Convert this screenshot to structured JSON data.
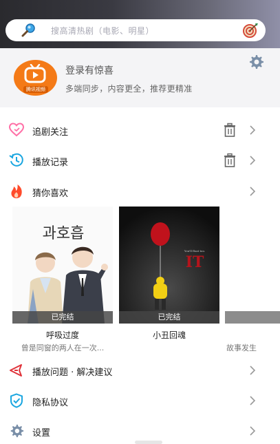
{
  "search": {
    "placeholder": "搜高清热剧（电影、明星）"
  },
  "profile": {
    "logo_text": "腾讯视频",
    "title": "登录有惊喜",
    "subtitle": "多端同步，内容更全，推荐更精准"
  },
  "menu": {
    "follow": "追剧关注",
    "history": "播放记录",
    "guess": "猜你喜欢",
    "feedback": "播放问题 · 解决建议",
    "privacy": "隐私协议",
    "settings": "设置"
  },
  "cards": [
    {
      "title": "呼吸过度",
      "desc": "曾是同窗的两人在一次...",
      "badge": "已完结",
      "poster_text": "과호흡"
    },
    {
      "title": "小丑回魂",
      "desc": "",
      "badge": "已完结",
      "poster_text": "IT"
    },
    {
      "title": "",
      "desc": "故事发生",
      "badge": ""
    }
  ],
  "colors": {
    "accent_orange": "#f47a17",
    "icon_blue": "#1aa6e0",
    "icon_red": "#ff4b4b",
    "icon_pink": "#ff6fa6"
  }
}
